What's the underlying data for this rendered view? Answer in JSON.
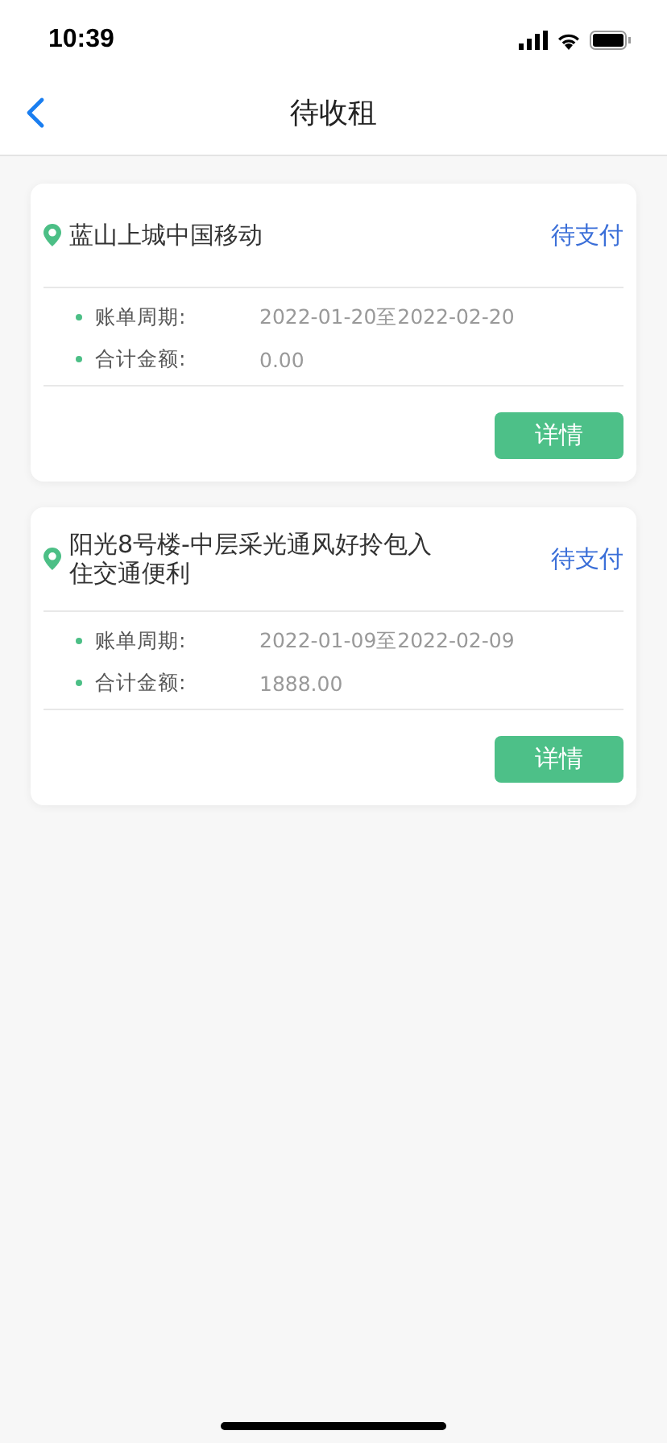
{
  "status_bar": {
    "time": "10:39"
  },
  "nav": {
    "title": "待收租"
  },
  "bills": [
    {
      "property": "蓝山上城中国移动",
      "status": "待支付",
      "fields": [
        {
          "label": "账单周期:",
          "value": "2022-01-20至2022-02-20"
        },
        {
          "label": "合计金额:",
          "value": "0.00"
        }
      ],
      "button": "详情"
    },
    {
      "property": "阳光8号楼-中层采光通风好拎包入住交通便利",
      "status": "待支付",
      "fields": [
        {
          "label": "账单周期:",
          "value": "2022-01-09至2022-02-09"
        },
        {
          "label": "合计金额:",
          "value": "1888.00"
        }
      ],
      "button": "详情"
    }
  ]
}
